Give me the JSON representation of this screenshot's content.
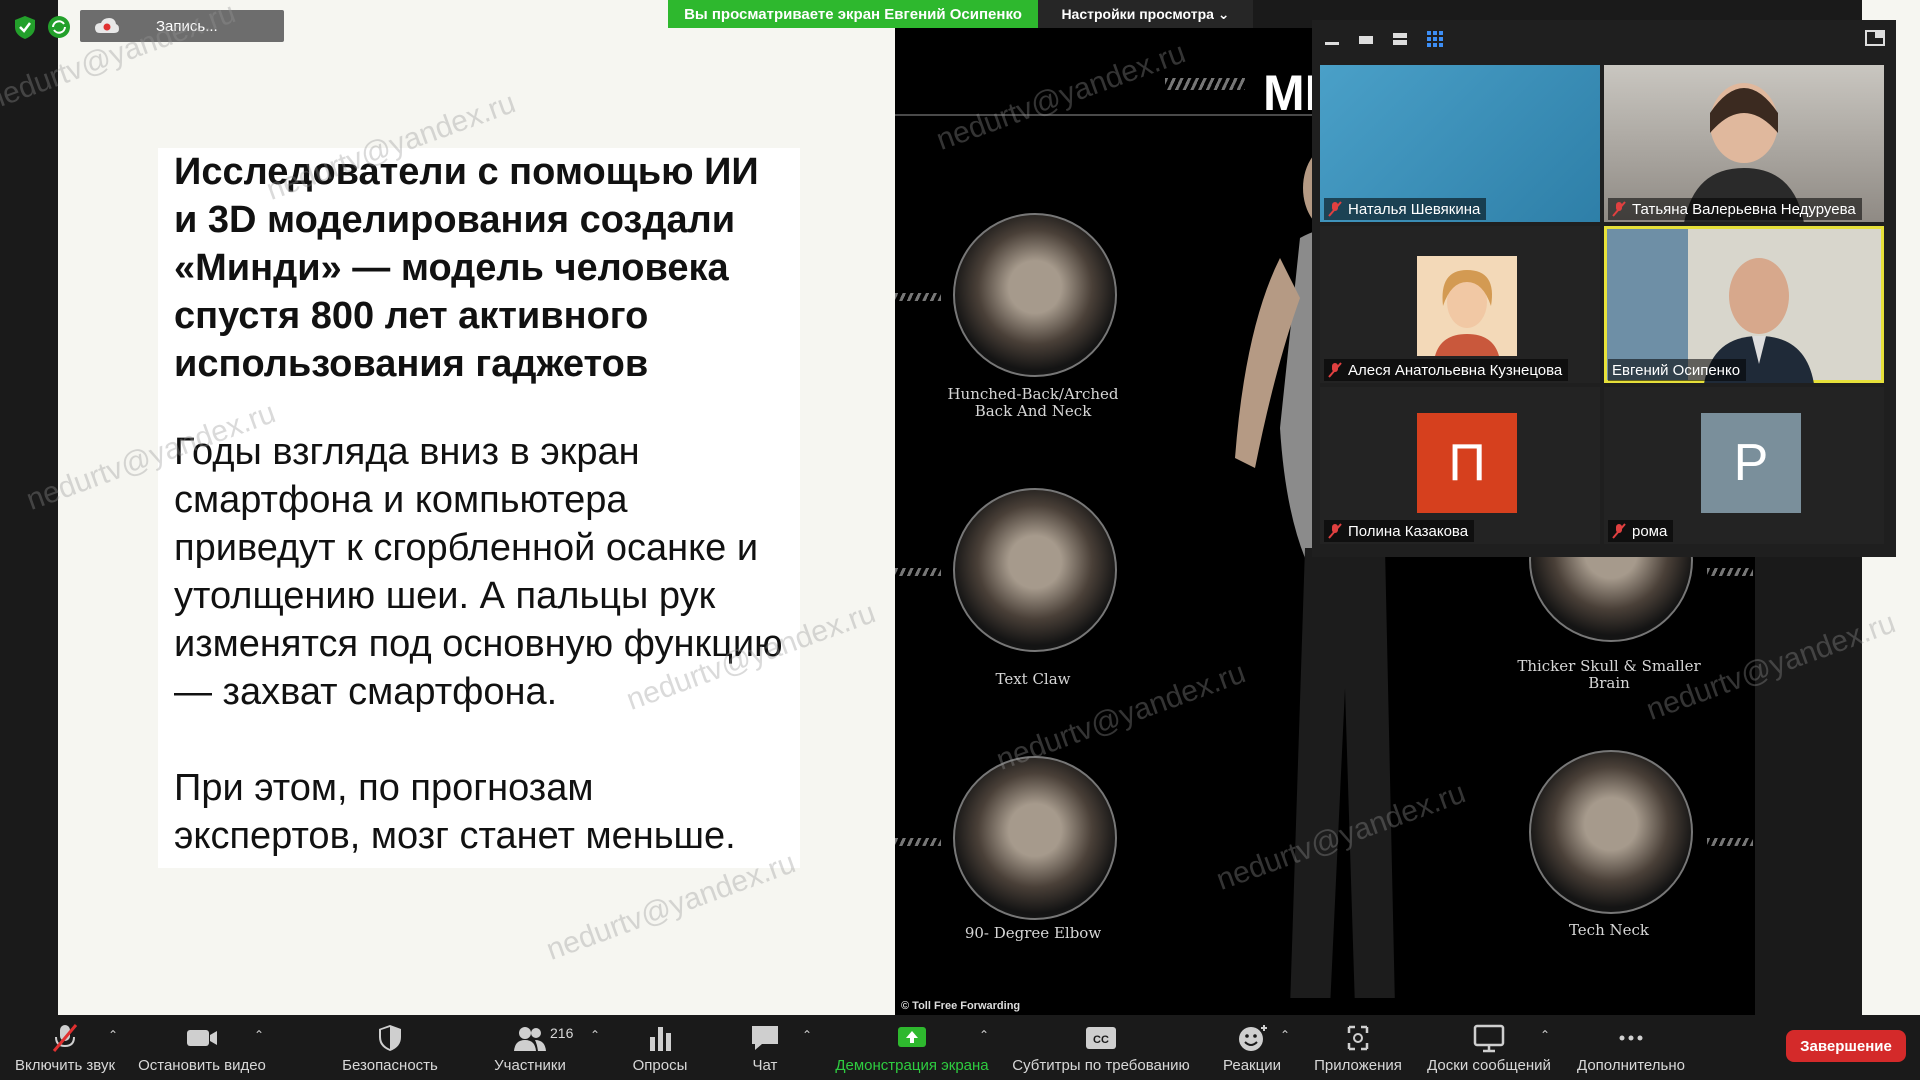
{
  "status": {
    "recording_label": "Запись...",
    "sharing_banner": "Вы просматриваете экран Евгений Осипенко",
    "view_options": "Настройки просмотра ⌄"
  },
  "slide": {
    "headline": "Исследователи с помощью ИИ и 3D моделирования создали «Минди» — модель человека спустя 800 лет активного использования гаджетов",
    "paragraph1": "Годы взгляда вниз в экран смартфона и компьютера приведут к сгорбленной осанке и утолщению шеи. А пальцы рук изменятся под основную функцию — захват смартфона.",
    "paragraph2": "При этом, по прогнозам экспертов, мозг станет меньше."
  },
  "photo": {
    "title_fragment": "MI",
    "credit": "© Toll Free Forwarding",
    "captions": [
      "Hunched-Back/Arched Back And Neck",
      "Text Claw",
      "90- Degree Elbow",
      "Thicker Skull & Smaller Brain",
      "Tech Neck"
    ]
  },
  "participants": [
    {
      "name": "Наталья Шевякина",
      "type": "video",
      "muted": true
    },
    {
      "name": "Татьяна Валерьевна Недуруева",
      "type": "video",
      "muted": true
    },
    {
      "name": "Алеся Анатольевна Кузнецова",
      "type": "photo",
      "muted": true
    },
    {
      "name": "Евгений Осипенко",
      "type": "video",
      "muted": false,
      "active": true
    },
    {
      "name": "Полина Казакова",
      "type": "avatar",
      "initial": "П",
      "color": "#d6401e",
      "muted": true
    },
    {
      "name": "рома",
      "type": "avatar",
      "initial": "Р",
      "color": "#7a8f9b",
      "muted": true
    }
  ],
  "toolbar": {
    "mute": "Включить звук",
    "video": "Остановить видео",
    "security": "Безопасность",
    "participants": "Участники",
    "participants_count": "216",
    "polls": "Опросы",
    "chat": "Чат",
    "share": "Демонстрация экрана",
    "captions": "Субтитры по требованию",
    "reactions": "Реакции",
    "apps": "Приложения",
    "whiteboards": "Доски сообщений",
    "more": "Дополнительно",
    "end": "Завершение"
  },
  "watermark": "nedurtv@yandex.ru",
  "colors": {
    "share_green": "#2eb82e",
    "end_red": "#d42a2a",
    "active_border": "#e6e03a"
  }
}
